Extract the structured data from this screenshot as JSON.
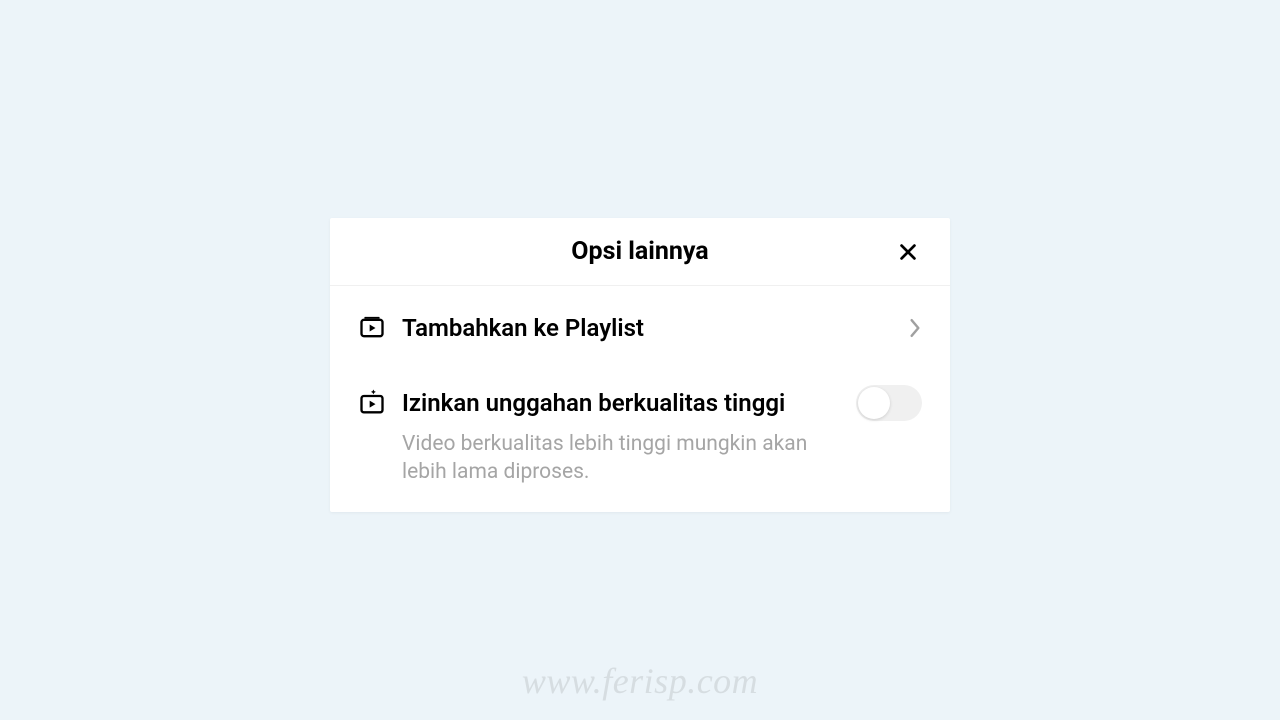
{
  "modal": {
    "title": "Opsi lainnya",
    "items": [
      {
        "label": "Tambahkan ke Playlist"
      },
      {
        "label": "Izinkan unggahan berkualitas tinggi",
        "description": "Video berkualitas lebih tinggi mungkin akan lebih lama diproses.",
        "toggle": false
      }
    ]
  },
  "watermark": "www.ferisp.com"
}
